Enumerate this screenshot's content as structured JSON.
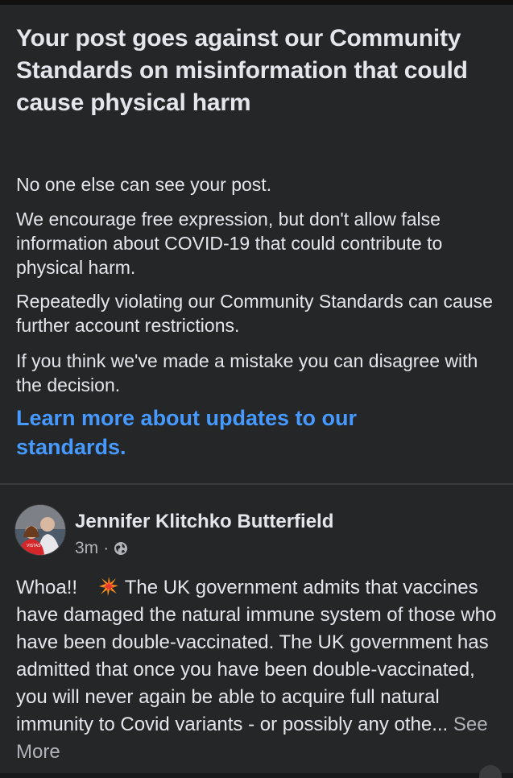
{
  "notice": {
    "title": "Your post goes against our Community Standards on misinformation that could cause physical harm",
    "paragraphs": [
      "No one else can see your post.",
      "We encourage free expression, but don't allow false information about COVID-19 that could contribute to physical harm.",
      "Repeatedly violating our Community Standards can cause further account restrictions.",
      "If you think we've made a mistake you can disagree with the decision."
    ],
    "link": "Learn more about updates to our standards."
  },
  "post": {
    "author": "Jennifer Klitchko Butterfield",
    "time": "3m",
    "separator": "·",
    "privacy_icon": "globe-icon",
    "text_before_icon": "Whoa!!",
    "inline_icon": "collision-spark-icon",
    "text_after_icon": "The UK government admits that vaccines have damaged the natural immune system of those who have been double-vaccinated. The UK government has admitted that once you have been double-vaccinated, you will never again be able to acquire full natural immunity to Covid variants - or possibly any othe...",
    "see_more": "See More"
  },
  "colors": {
    "background": "#252628",
    "text": "#e4e6eb",
    "secondary_text": "#b0b3b8",
    "link": "#4599ff"
  }
}
